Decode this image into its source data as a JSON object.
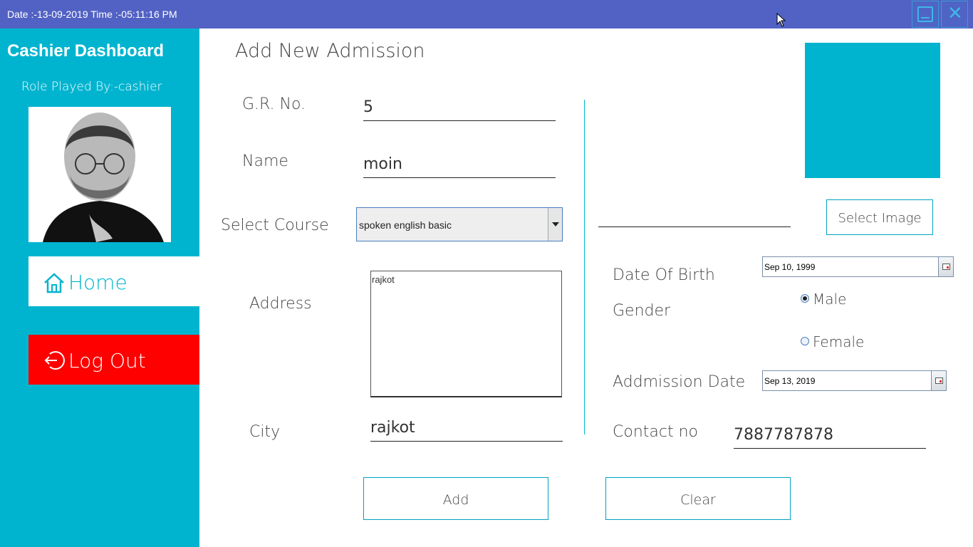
{
  "titlebar": {
    "datetime": "Date :-13-09-2019 Time :-05:11:16 PM",
    "minimize_icon": "minimize-icon",
    "close_icon": "close-icon"
  },
  "sidebar": {
    "title": "Cashier Dashboard",
    "role": "Role Played By:-cashier",
    "home_label": "Home",
    "home_icon": "house-icon",
    "logout_label": "Log Out",
    "logout_icon": "logout-icon",
    "colors": {
      "background": "#00b4cf",
      "logout": "#ff0000"
    }
  },
  "form": {
    "title": "Add New Admission",
    "gr_label": "G.R. No.",
    "gr_value": "5",
    "name_label": "Name",
    "name_value": "moin",
    "course_label": "Select Course",
    "course_value": "spoken english basic",
    "address_label": "Address",
    "address_value": "rajkot",
    "city_label": "City",
    "city_value": "rajkot",
    "select_image_label": "Select Image",
    "dob_label": "Date Of Birth",
    "dob_value": "Sep 10, 1999",
    "gender_label": "Gender",
    "gender_male": "Male",
    "gender_female": "Female",
    "gender_selected": "Male",
    "admission_label": "Addmission Date",
    "admission_value": "Sep 13, 2019",
    "contact_label": "Contact no",
    "contact_value": "7887787878",
    "add_label": "Add",
    "clear_label": "Clear"
  }
}
